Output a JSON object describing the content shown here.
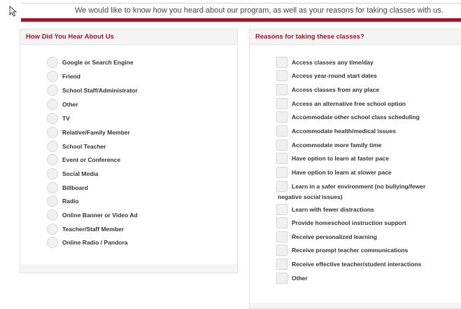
{
  "intro_text": "We would like to know how you heard about our program, as well as your reasons for taking classes with us.",
  "accent_color": "#a0182e",
  "left_panel": {
    "title": "How Did You Hear About Us",
    "options": [
      "Google or Search Engine",
      "Friend",
      "School Staff/Administrator",
      "Other",
      "TV",
      "Relative/Family Member",
      "School Teacher",
      "Event or Conference",
      "Social Media",
      "Billboard",
      "Radio",
      "Online Banner or Video Ad",
      "Teacher/Staff Member",
      "Online Radio / Pandora"
    ]
  },
  "right_panel": {
    "title": "Reasons for taking these classes?",
    "options": [
      "Access classes any time/day",
      "Access year-round start dates",
      "Access classes from any place",
      "Access an alternative free school option",
      "Accommodate other school class scheduling",
      "Accommodate health/medical issues",
      "Accommodate more family time",
      "Have option to learn at faster pace",
      "Have option to learn at slower pace",
      "Learn in a safer environment (no bullying/fewer",
      "Learn with fewer distractions",
      "Provide homeschool instruction support",
      "Receive personalized learning",
      "Receive prompt teacher communications",
      "Receive effective teacher/student interactions",
      "Other"
    ],
    "wrapped_continuation": "negative social issues)"
  }
}
